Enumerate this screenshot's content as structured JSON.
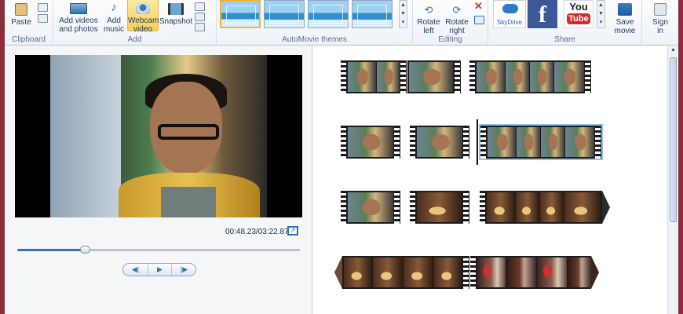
{
  "ribbon": {
    "clipboard": {
      "paste_label": "Paste",
      "group_label": "Clipboard"
    },
    "add": {
      "add_videos_label_1": "Add videos",
      "add_videos_label_2": "and photos",
      "add_music_label_1": "Add",
      "add_music_label_2": "music",
      "webcam_label_1": "Webcam",
      "webcam_label_2": "video",
      "snapshot_label": "Snapshot",
      "group_label": "Add"
    },
    "themes": {
      "group_label": "AutoMovie themes",
      "count_visible": 4,
      "selected_index": 0
    },
    "editing": {
      "rotate_left_1": "Rotate",
      "rotate_left_2": "left",
      "rotate_right_1": "Rotate",
      "rotate_right_2": "right",
      "group_label": "Editing"
    },
    "share": {
      "skydrive_label": "SkyDrive",
      "facebook_glyph": "f",
      "youtube_you": "You",
      "youtube_tube": "Tube",
      "save_movie_1": "Save",
      "save_movie_2": "movie",
      "group_label": "Share"
    },
    "sign_in": {
      "label_1": "Sign",
      "label_2": "in"
    }
  },
  "preview": {
    "timecode": "00:48.23/03:22.87",
    "progress": 0.24
  },
  "colors": {
    "accent": "#2f74b5",
    "facebook": "#3b5998",
    "youtube": "#d52b2b",
    "selected": "#f8cd5c"
  }
}
